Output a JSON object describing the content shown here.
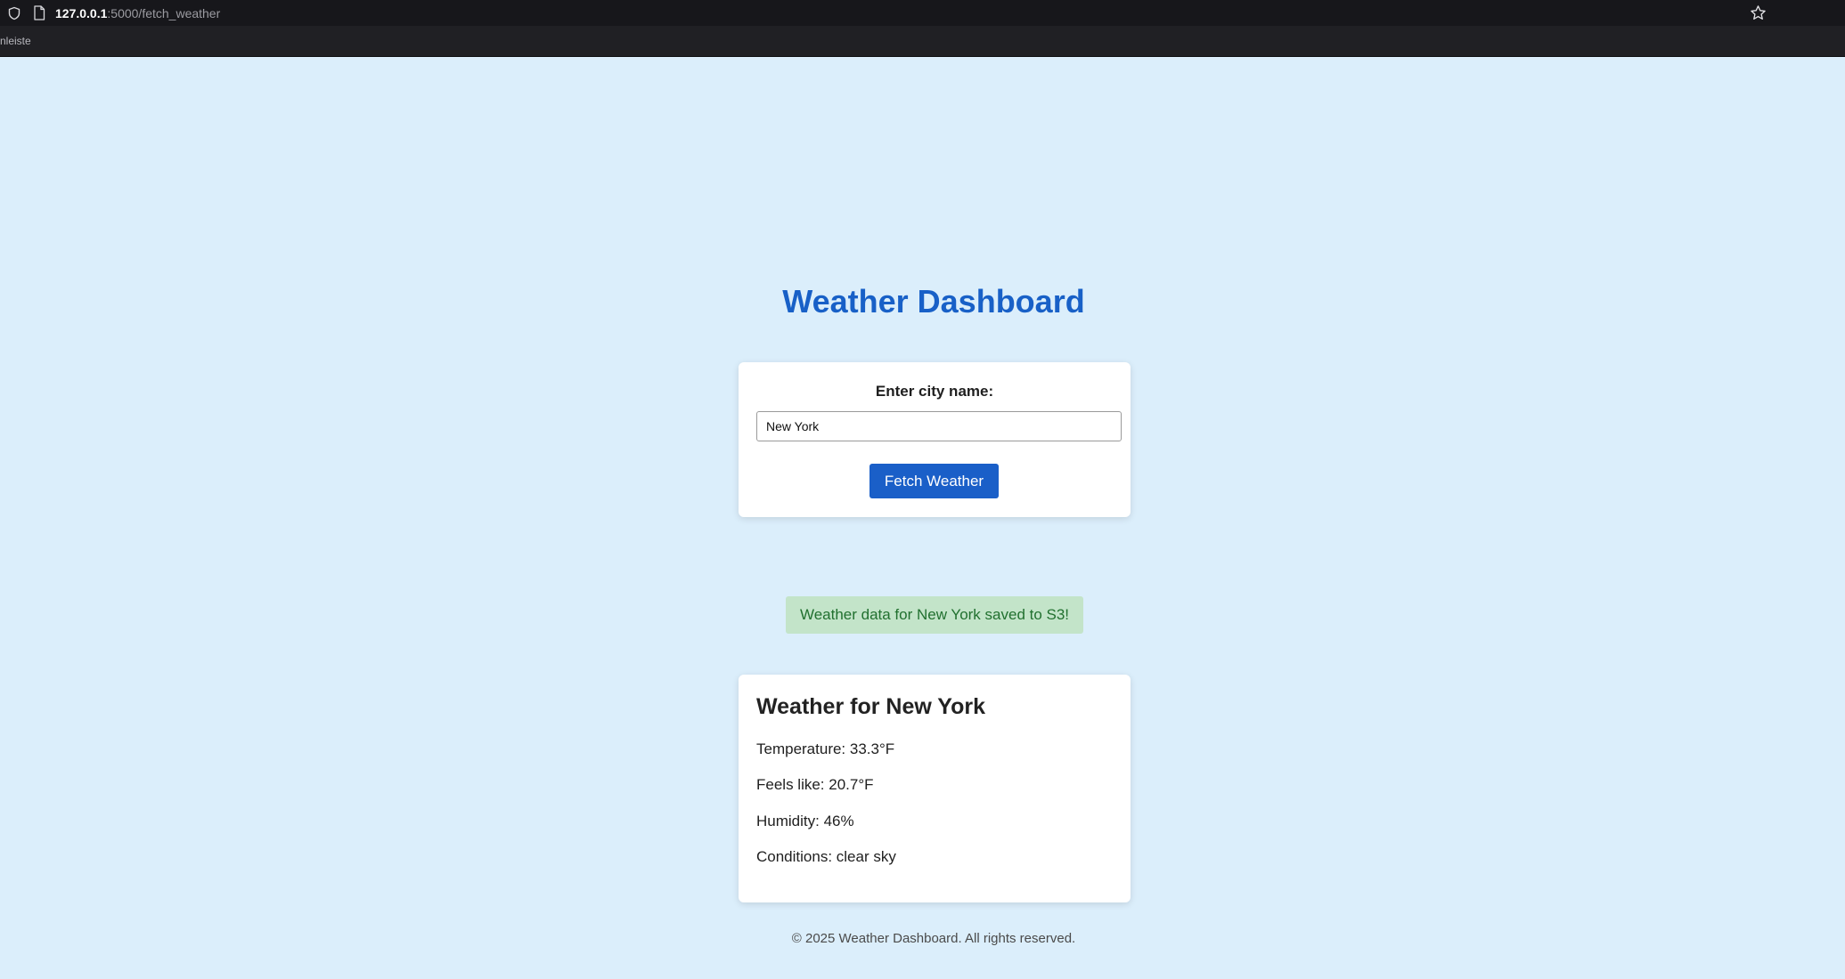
{
  "browser": {
    "url_host": "127.0.0.1",
    "url_path": ":5000/fetch_weather",
    "bookmarks_label": "nleiste"
  },
  "page": {
    "title": "Weather Dashboard",
    "form": {
      "label": "Enter city name:",
      "city_value": "New York",
      "button_label": "Fetch Weather"
    },
    "alert": "Weather data for New York saved to S3!",
    "result": {
      "heading": "Weather for New York",
      "temperature": "Temperature: 33.3°F",
      "feels_like": "Feels like: 20.7°F",
      "humidity": "Humidity: 46%",
      "conditions": "Conditions: clear sky"
    },
    "footer": "© 2025 Weather Dashboard. All rights reserved."
  },
  "colors": {
    "page_background": "#dbeefb",
    "accent": "#1a5fc8",
    "alert_background": "#c3e4c9",
    "alert_text": "#21702f"
  },
  "icons": [
    "shield-icon",
    "page-icon",
    "bookmark-star-icon"
  ]
}
